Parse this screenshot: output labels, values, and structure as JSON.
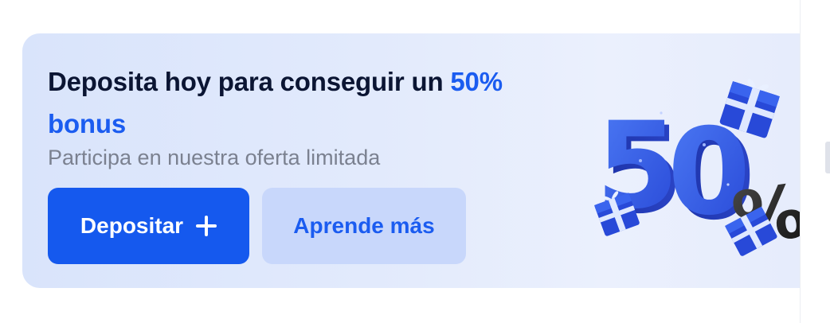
{
  "promo": {
    "headline_prefix": "Deposita hoy para conseguir un ",
    "headline_accent": "50% bonus",
    "subtitle": "Participa en nuestra oferta limitada",
    "primary_button_label": "Depositar",
    "secondary_button_label": "Aprende más",
    "art_icon": "fifty-percent-gifts-illustration"
  },
  "colors": {
    "accent": "#1b5cf0",
    "primary_button": "#1559ee",
    "secondary_button": "#c8d7fb",
    "card_background": "#dfe8fc",
    "headline": "#0b1533",
    "subtitle": "#7b8190"
  }
}
